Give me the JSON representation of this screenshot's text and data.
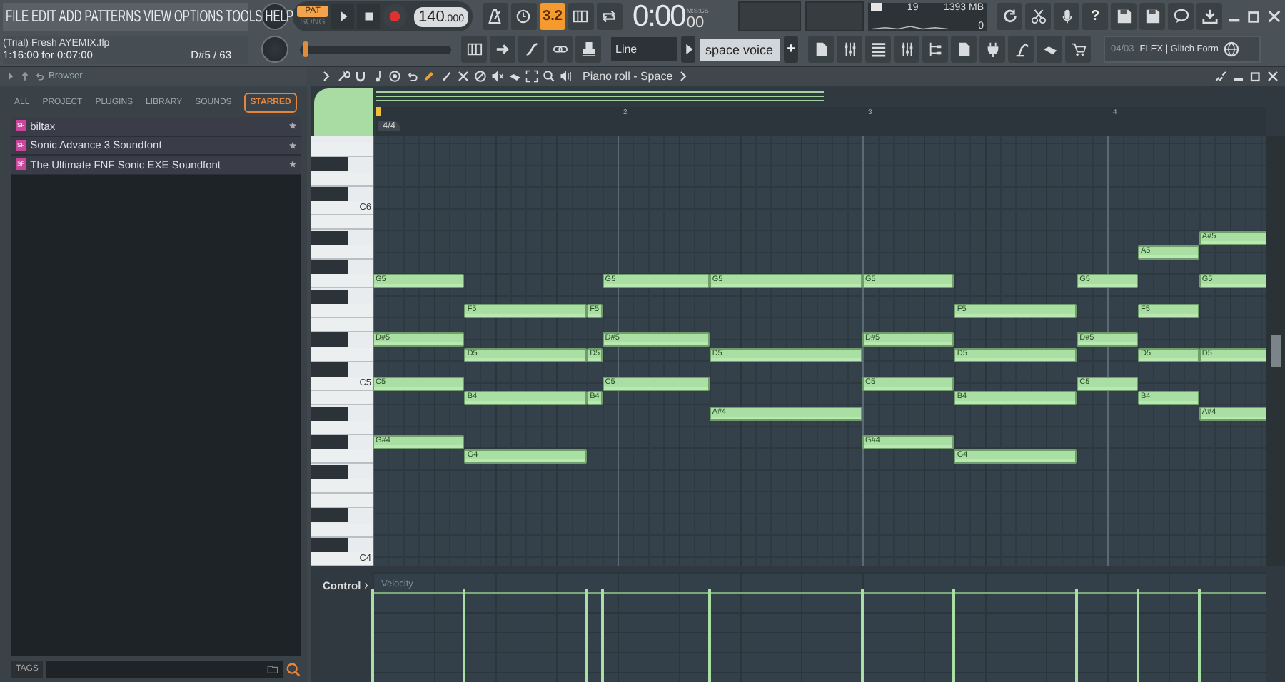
{
  "menu": [
    "FILE",
    "EDIT",
    "ADD",
    "PATTERNS",
    "VIEW",
    "OPTIONS",
    "TOOLS",
    "HELP"
  ],
  "project": {
    "title": "(Trial) Fresh AYEMIX.flp",
    "time": "1:16:00 for 0:07:00",
    "note": "D#5 / 63"
  },
  "song_position": {
    "level": 0.02
  },
  "transport": {
    "modes": [
      {
        "label": "PAT",
        "selected": true
      },
      {
        "label": "SONG",
        "selected": false
      }
    ],
    "tempo": "140",
    "tempo_decimals": ".000"
  },
  "snap_toggle": {
    "label": "3.2",
    "on": true
  },
  "clock": {
    "time": "0:00",
    "centiseconds": "00",
    "unit": "M:S:CS"
  },
  "cpu": {
    "count": "19",
    "memory": "1393 MB",
    "polyphony": "0"
  },
  "help_button": "?",
  "tool_row": {
    "snap": "Line",
    "pattern": "space voice",
    "add": "+",
    "hint_position": "04/03",
    "hint_text": "FLEX | Glitch Form"
  },
  "browser": {
    "title": "Browser",
    "tabs": [
      {
        "label": "ALL",
        "selected": false
      },
      {
        "label": "PROJECT",
        "selected": false
      },
      {
        "label": "PLUGINS",
        "selected": false
      },
      {
        "label": "LIBRARY",
        "selected": false
      },
      {
        "label": "SOUNDS",
        "selected": false
      },
      {
        "label": "STARRED",
        "selected": true
      }
    ],
    "items": [
      {
        "badge": "SF",
        "name": "biltax"
      },
      {
        "badge": "SF",
        "name": "Sonic Advance 3 Soundfont"
      },
      {
        "badge": "SF",
        "name": "The Ultimate FNF Sonic EXE Soundfont"
      }
    ],
    "tags_label": "TAGS"
  },
  "piano_roll": {
    "title": "Piano roll - Space",
    "ruler": [
      "2",
      "3",
      "4"
    ],
    "time_signature": "4/4",
    "key_labels": [
      "C6",
      "C5",
      "C4"
    ],
    "notes": [
      {
        "label": "A#5"
      },
      {
        "label": "A5"
      },
      {
        "label": "G5"
      },
      {
        "label": "G5"
      },
      {
        "label": "G5"
      },
      {
        "label": "G5"
      },
      {
        "label": "G5"
      },
      {
        "label": "G5"
      },
      {
        "label": "F5"
      },
      {
        "label": "F5"
      },
      {
        "label": "F5"
      },
      {
        "label": "F5"
      },
      {
        "label": "D#5"
      },
      {
        "label": "D#5"
      },
      {
        "label": "D#5"
      },
      {
        "label": "D#5"
      },
      {
        "label": "D5"
      },
      {
        "label": "D5"
      },
      {
        "label": "D5"
      },
      {
        "label": "D5"
      },
      {
        "label": "D5"
      },
      {
        "label": "D5"
      },
      {
        "label": "C5"
      },
      {
        "label": "C5"
      },
      {
        "label": "C5"
      },
      {
        "label": "C5"
      },
      {
        "label": "B4"
      },
      {
        "label": "B4"
      },
      {
        "label": "B4"
      },
      {
        "label": "B4"
      },
      {
        "label": "A#4"
      },
      {
        "label": "A#4"
      },
      {
        "label": "G#4"
      },
      {
        "label": "G#4"
      },
      {
        "label": "G4"
      },
      {
        "label": "G4"
      }
    ],
    "control": {
      "label": "Control",
      "parameter": "Velocity"
    }
  }
}
